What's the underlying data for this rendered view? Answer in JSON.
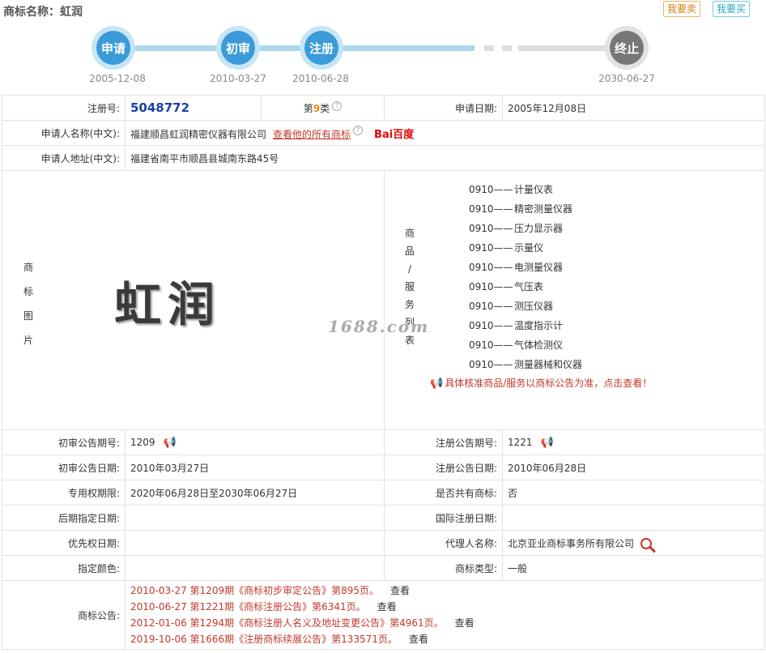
{
  "header": {
    "title": "商标名称：虹润",
    "sell_label": "我要卖",
    "buy_label": "我要买"
  },
  "timeline": [
    {
      "label": "申请",
      "date": "2005-12-08"
    },
    {
      "label": "初审",
      "date": "2010-03-27"
    },
    {
      "label": "注册",
      "date": "2010-06-28"
    },
    {
      "label": "终止",
      "date": "2030-06-27"
    }
  ],
  "info": {
    "reg_no_label": "注册号:",
    "reg_no": "5048772",
    "class_prefix": "第",
    "class_num": "9",
    "class_suffix": "类",
    "apply_date_label": "申请日期:",
    "apply_date": "2005年12月08日",
    "applicant_label": "申请人名称(中文):",
    "applicant": "福建顺昌虹润精密仪器有限公司",
    "view_all_label": "查看他的所有商标",
    "baidu_label": "Bai百度",
    "address_label": "申请人地址(中文):",
    "address": "福建省南平市顺昌县城南东路45号",
    "image_label_chars": [
      "商",
      "标",
      "图",
      "片"
    ],
    "mark_text": "虹润",
    "goods_label_chars": [
      "商",
      "品",
      "/",
      "服",
      "务",
      "列",
      "表"
    ],
    "goods": [
      {
        "code": "0910——",
        "name": "计量仪表"
      },
      {
        "code": "0910——",
        "name": "精密测量仪器"
      },
      {
        "code": "0910——",
        "name": "压力显示器"
      },
      {
        "code": "0910——",
        "name": "示量仪"
      },
      {
        "code": "0910——",
        "name": "电测量仪器"
      },
      {
        "code": "0910——",
        "name": "气压表"
      },
      {
        "code": "0910——",
        "name": "测压仪器"
      },
      {
        "code": "0910——",
        "name": "温度指示计"
      },
      {
        "code": "0910——",
        "name": "气体检测仪"
      },
      {
        "code": "0910——",
        "name": "测量器械和仪器"
      }
    ],
    "goods_note": "具体核准商品/服务以商标公告为准，点击查看！",
    "watermark": "1688.com",
    "prelim_no_label": "初审公告期号:",
    "prelim_no": "1209",
    "reg_ann_no_label": "注册公告期号:",
    "reg_ann_no": "1221",
    "prelim_date_label": "初审公告日期:",
    "prelim_date": "2010年03月27日",
    "reg_ann_date_label": "注册公告日期:",
    "reg_ann_date": "2010年06月28日",
    "exclusive_label": "专用权期限:",
    "exclusive": "2020年06月28日至2030年06月27日",
    "shared_label": "是否共有商标:",
    "shared": "否",
    "later_label": "后期指定日期:",
    "later": "",
    "intl_label": "国际注册日期:",
    "intl": "",
    "priority_label": "优先权日期:",
    "priority": "",
    "agent_label": "代理人名称:",
    "agent": "北京亚业商标事务所有限公司",
    "color_label": "指定颜色:",
    "color": "",
    "type_label": "商标类型:",
    "type": "一般",
    "announce_label": "商标公告:",
    "announcements": [
      {
        "text": "2010-03-27 第1209期《商标初步审定公告》第895页。",
        "view": "查看"
      },
      {
        "text": "2010-06-27 第1221期《商标注册公告》第6341页。",
        "view": "查看"
      },
      {
        "text": "2012-01-06 第1294期《商标注册人名义及地址变更公告》第4961页。",
        "view": "查看"
      },
      {
        "text": "2019-10-06 第1666期《注册商标续展公告》第133571页。",
        "view": "查看"
      }
    ]
  },
  "colors": {
    "accent_blue": "#3a9bd8",
    "node_gray": "#777777",
    "link_red": "#c0392b",
    "class_orange": "#e8870b"
  }
}
